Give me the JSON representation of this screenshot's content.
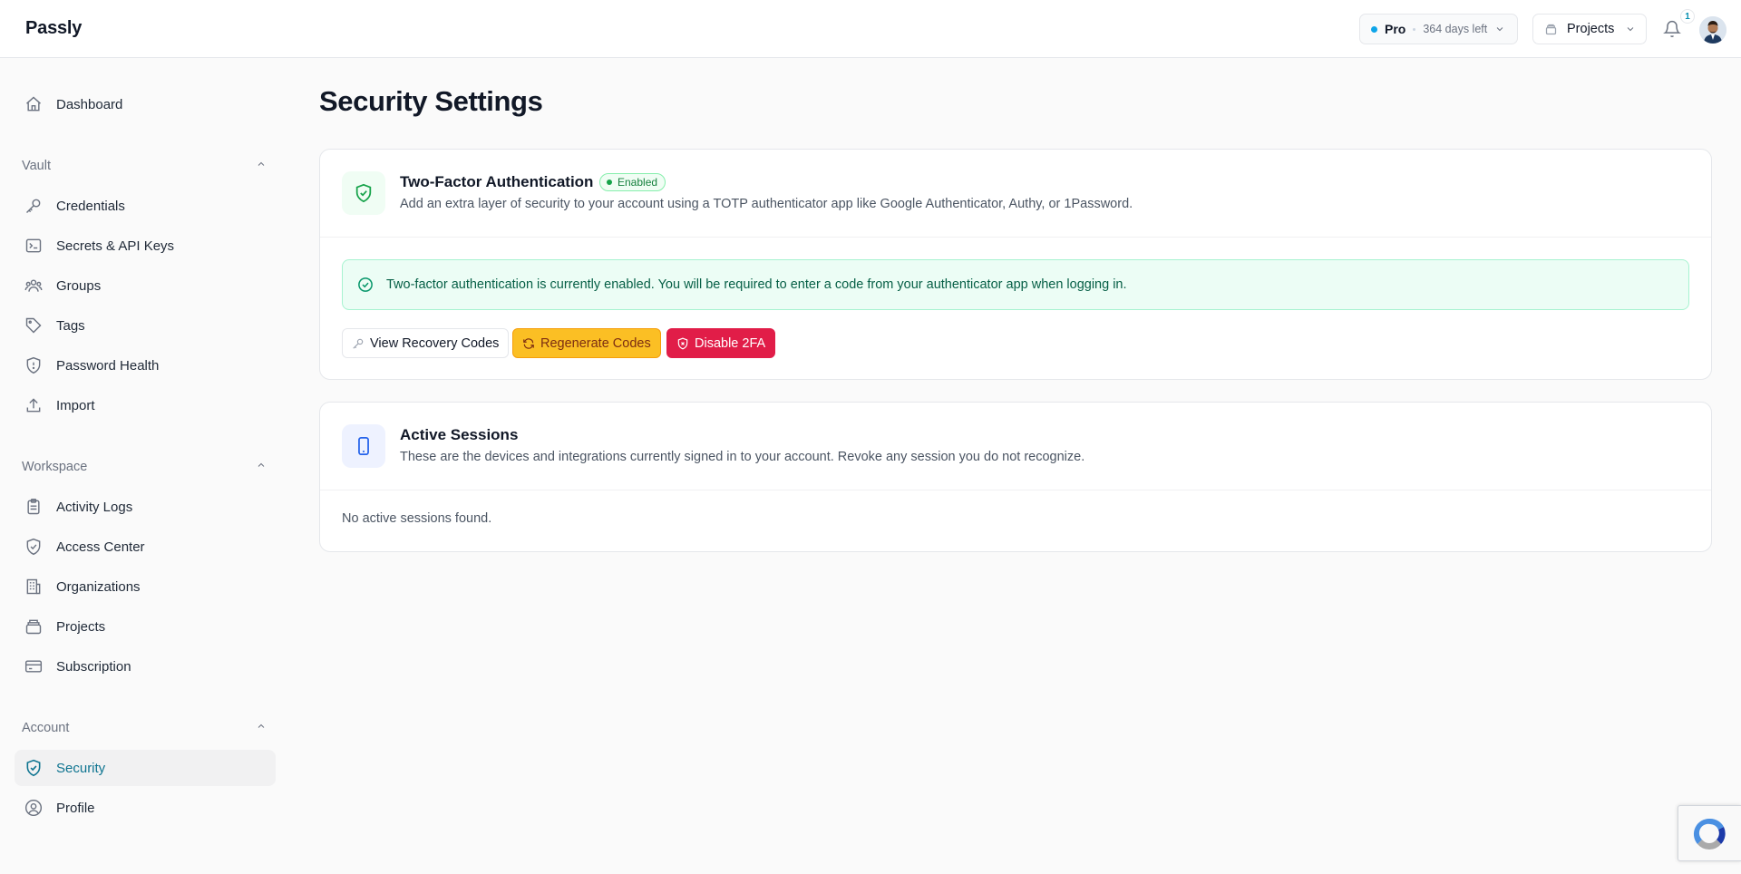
{
  "app": {
    "name": "Passly"
  },
  "header": {
    "plan_name": "Pro",
    "plan_days": "364 days left",
    "projects_label": "Projects",
    "notification_count": "1"
  },
  "sidebar": {
    "top": [
      {
        "label": "Dashboard",
        "icon": "home-icon"
      }
    ],
    "sections": [
      {
        "label": "Vault",
        "items": [
          {
            "label": "Credentials",
            "icon": "key-icon"
          },
          {
            "label": "Secrets & API Keys",
            "icon": "terminal-icon"
          },
          {
            "label": "Groups",
            "icon": "users-icon"
          },
          {
            "label": "Tags",
            "icon": "tag-icon"
          },
          {
            "label": "Password Health",
            "icon": "shield-alert-icon"
          },
          {
            "label": "Import",
            "icon": "upload-icon"
          }
        ]
      },
      {
        "label": "Workspace",
        "items": [
          {
            "label": "Activity Logs",
            "icon": "clipboard-icon"
          },
          {
            "label": "Access Center",
            "icon": "shield-check-icon"
          },
          {
            "label": "Organizations",
            "icon": "building-icon"
          },
          {
            "label": "Projects",
            "icon": "layers-icon"
          },
          {
            "label": "Subscription",
            "icon": "credit-card-icon"
          }
        ]
      },
      {
        "label": "Account",
        "items": [
          {
            "label": "Security",
            "icon": "shield-check-icon",
            "active": true
          },
          {
            "label": "Profile",
            "icon": "user-circle-icon"
          }
        ]
      }
    ]
  },
  "page": {
    "title": "Security Settings"
  },
  "twofa": {
    "title": "Two-Factor Authentication",
    "badge": "Enabled",
    "description": "Add an extra layer of security to your account using a TOTP authenticator app like Google Authenticator, Authy, or 1Password.",
    "alert": "Two-factor authentication is currently enabled. You will be required to enter a code from your authenticator app when logging in.",
    "buttons": {
      "view": "View Recovery Codes",
      "regenerate": "Regenerate Codes",
      "disable": "Disable 2FA"
    }
  },
  "sessions": {
    "title": "Active Sessions",
    "description": "These are the devices and integrations currently signed in to your account. Revoke any session you do not recognize.",
    "empty": "No active sessions found."
  },
  "colors": {
    "accent": "#0e7490",
    "success": "#15803d",
    "warning": "#fbbf24",
    "danger": "#e11d48"
  }
}
